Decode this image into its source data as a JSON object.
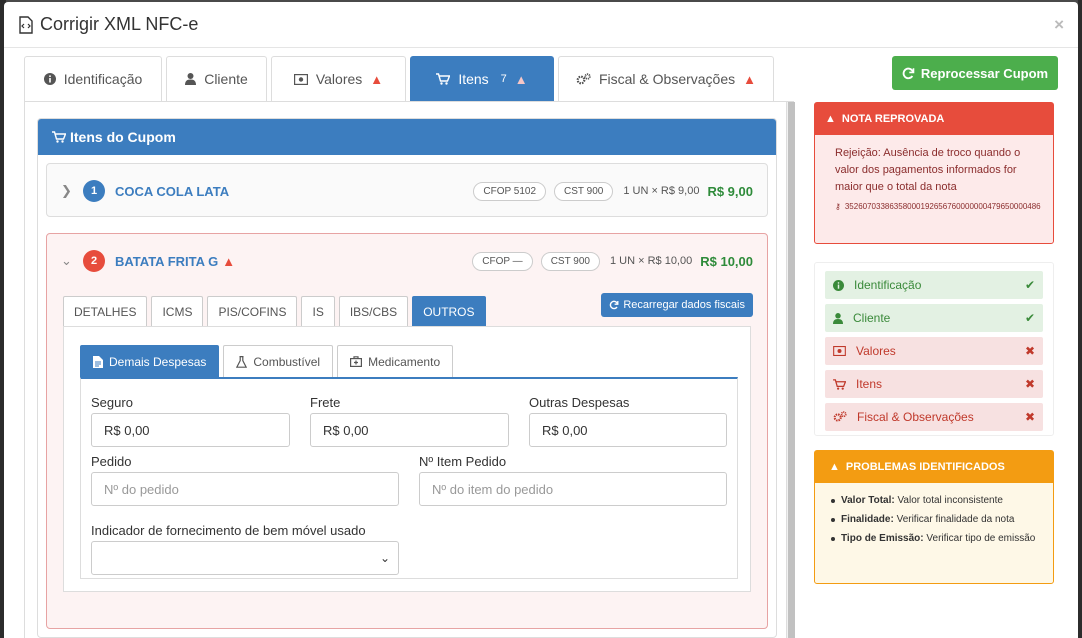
{
  "modal": {
    "title": "Corrigir XML NFC-e",
    "close": "×"
  },
  "main_tabs": [
    {
      "label": "Identificação",
      "icon": "info-icon",
      "warn": false
    },
    {
      "label": "Cliente",
      "icon": "user-icon",
      "warn": false
    },
    {
      "label": "Valores",
      "icon": "money-icon",
      "warn": true
    },
    {
      "label": "Itens",
      "icon": "cart-icon",
      "count": "7",
      "warn": true,
      "active": true
    },
    {
      "label": "Fiscal & Observações",
      "icon": "gears-icon",
      "warn": true
    }
  ],
  "items_section": {
    "title": "Itens do Cupom"
  },
  "items": [
    {
      "number": "1",
      "name": "COCA COLA LATA",
      "cfop": "CFOP 5102",
      "cst": "CST 900",
      "qty": "1 UN × R$ 9,00",
      "total": "R$ 9,00"
    },
    {
      "number": "2",
      "name": "BATATA FRITA G",
      "cfop": "CFOP —",
      "cst": "CST 900",
      "qty": "1 UN × R$ 10,00",
      "total": "R$ 10,00"
    }
  ],
  "sub_tabs": [
    "DETALHES",
    "ICMS",
    "PIS/COFINS",
    "IS",
    "IBS/CBS",
    "OUTROS"
  ],
  "reload_button": "Recarregar dados fiscais",
  "third_tabs": [
    "Demais Despesas",
    "Combustível",
    "Medicamento"
  ],
  "form": {
    "seguro_label": "Seguro",
    "seguro_value": "R$ 0,00",
    "frete_label": "Frete",
    "frete_value": "R$ 0,00",
    "outras_label": "Outras Despesas",
    "outras_value": "R$ 0,00",
    "pedido_label": "Pedido",
    "pedido_placeholder": "Nº do pedido",
    "item_pedido_label": "Nº Item Pedido",
    "item_pedido_placeholder": "Nº do item do pedido",
    "indicador_label": "Indicador de fornecimento de bem móvel usado",
    "indicador_value": ""
  },
  "sidebar": {
    "reprocess_button": "Reprocessar Cupom",
    "rejection": {
      "title": "NOTA REPROVADA",
      "message": "Rejeição: Ausência de troco quando o valor dos pagamentos informados for maior que o total da nota",
      "key": "35260703386358000192656760000000479650000486"
    },
    "status": [
      {
        "label": "Identificação",
        "icon": "info-icon",
        "ok": true
      },
      {
        "label": "Cliente",
        "icon": "user-icon",
        "ok": true
      },
      {
        "label": "Valores",
        "icon": "money-icon",
        "ok": false
      },
      {
        "label": "Itens",
        "icon": "cart-icon",
        "ok": false
      },
      {
        "label": "Fiscal & Observações",
        "icon": "gears-icon",
        "ok": false
      }
    ],
    "problems": {
      "title": "PROBLEMAS IDENTIFICADOS",
      "list": [
        {
          "key": "Valor Total:",
          "text": "Valor total inconsistente"
        },
        {
          "key": "Finalidade:",
          "text": "Verificar finalidade da nota"
        },
        {
          "key": "Tipo de Emissão:",
          "text": "Verificar tipo de emissão"
        }
      ]
    }
  },
  "colors": {
    "primary": "#3c7dbf",
    "success": "#4cae4c",
    "danger": "#e74c3c",
    "warning": "#f39c12"
  }
}
